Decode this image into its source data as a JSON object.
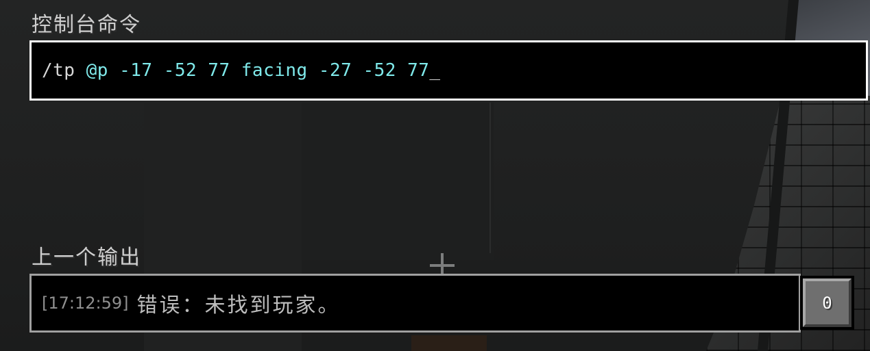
{
  "console": {
    "title": "控制台命令",
    "command": {
      "slash": "/tp ",
      "args": "@p -17 -52 77 facing -27 -52 77",
      "cursor": "_"
    }
  },
  "output": {
    "title": "上一个输出",
    "timestamp": "[17:12:59]",
    "message": "错误：未找到玩家。"
  },
  "side_button": {
    "label": "0"
  },
  "colors": {
    "command_highlight": "#7fe9ea",
    "box_border": "#ffffff",
    "output_border": "#a0a0a0"
  },
  "icons": {
    "crosshair": "crosshair-icon"
  }
}
